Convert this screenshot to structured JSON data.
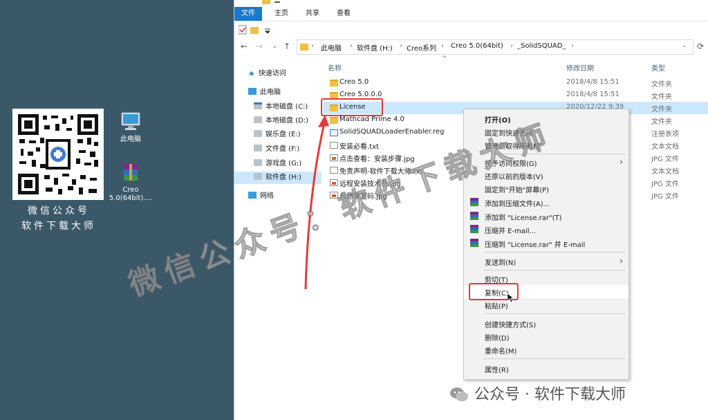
{
  "desktop": {
    "qr_caption_line1": "微信公众号",
    "qr_caption_line2": "软件下载大师",
    "icons": [
      {
        "label": "此电脑",
        "icon": "computer-icon"
      },
      {
        "label": "Creo\n5.0(64bit)....",
        "icon": "winrar-archive-icon"
      }
    ]
  },
  "ribbon": {
    "tabs": [
      "文件",
      "主页",
      "共享",
      "查看"
    ],
    "active_tab": "文件"
  },
  "address": {
    "path": [
      "此电脑",
      "软件盘 (H:)",
      "Creo系列",
      "Creo 5.0(64bit)",
      "_SolidSQUAD_"
    ]
  },
  "nav": {
    "items": [
      {
        "label": "快速访问",
        "icon": "quick-access-icon"
      },
      {
        "label": "此电脑",
        "icon": "computer-icon"
      },
      {
        "label": "本地磁盘 (C:)",
        "icon": "drive-c-icon"
      },
      {
        "label": "本地磁盘 (D:)",
        "icon": "drive-icon"
      },
      {
        "label": "娱乐盘 (E:)",
        "icon": "drive-icon"
      },
      {
        "label": "文件盘 (F:)",
        "icon": "drive-icon"
      },
      {
        "label": "游戏盘 (G:)",
        "icon": "drive-icon"
      },
      {
        "label": "软件盘 (H:)",
        "icon": "drive-icon"
      },
      {
        "label": "网络",
        "icon": "network-icon"
      }
    ],
    "selected": "软件盘 (H:)"
  },
  "columns": {
    "name": "名称",
    "date": "修改日期",
    "type": "类型"
  },
  "files": [
    {
      "name": "Creo 5.0",
      "date": "2018/4/8 15:51",
      "type": "文件夹",
      "icon": "folder-icon"
    },
    {
      "name": "Creo 5.0.0.0",
      "date": "2018/4/8 15:51",
      "type": "文件夹",
      "icon": "folder-icon"
    },
    {
      "name": "License",
      "date": "2020/12/22 9:39",
      "type": "文件夹",
      "icon": "folder-icon"
    },
    {
      "name": "Mathcad Prime 4.0",
      "date": "",
      "type": "文件夹",
      "icon": "folder-icon"
    },
    {
      "name": "SolidSQUADLoaderEnabler.reg",
      "date": "",
      "type": "注册表项",
      "icon": "registry-icon"
    },
    {
      "name": "安装必看.txt",
      "date": "",
      "type": "文本文档",
      "icon": "text-file-icon"
    },
    {
      "name": "点击查看：安装步骤.jpg",
      "date": "",
      "type": "JPG 文件",
      "icon": "image-file-icon"
    },
    {
      "name": "免责声明-软件下载大师.txt",
      "date": "",
      "type": "文本文档",
      "icon": "text-file-icon"
    },
    {
      "name": "远程安装技术员.jpg",
      "date": "",
      "type": "JPG 文件",
      "icon": "image-file-icon"
    },
    {
      "name": "自愿赞赏码.jpg",
      "date": "",
      "type": "JPG 文件",
      "icon": "image-file-icon"
    }
  ],
  "context_menu": {
    "items": [
      {
        "label": "打开(O)",
        "bold": true
      },
      {
        "label": "固定到快速访问"
      },
      {
        "label": "管理员取得所有权"
      },
      {
        "label": "授予访问权限(G)",
        "submenu": true
      },
      {
        "label": "还原以前的版本(V)"
      },
      {
        "label": "固定到\"开始\"屏幕(P)"
      },
      {
        "label": "添加到压缩文件(A)...",
        "icon": "winrar-icon"
      },
      {
        "label": "添加到 \"License.rar\"(T)",
        "icon": "winrar-icon"
      },
      {
        "label": "压缩并 E-mail...",
        "icon": "winrar-icon"
      },
      {
        "label": "压缩到 \"License.rar\" 并 E-mail",
        "icon": "winrar-icon"
      },
      {
        "label": "发送到(N)",
        "submenu": true
      },
      {
        "label": "剪切(T)"
      },
      {
        "label": "复制(C)",
        "highlighted": true
      },
      {
        "label": "粘贴(P)"
      },
      {
        "label": "创建快捷方式(S)"
      },
      {
        "label": "删除(D)"
      },
      {
        "label": "重命名(M)"
      },
      {
        "label": "属性(R)"
      }
    ]
  },
  "watermark": {
    "diagonal": "微信公众号：软件下载大师",
    "footer": "公众号 · 软件下载大师"
  },
  "colors": {
    "desktop_bg": "#3b5869",
    "accent": "#1979ca",
    "selection": "#cce8ff",
    "highlight_box": "#e23b3b"
  }
}
